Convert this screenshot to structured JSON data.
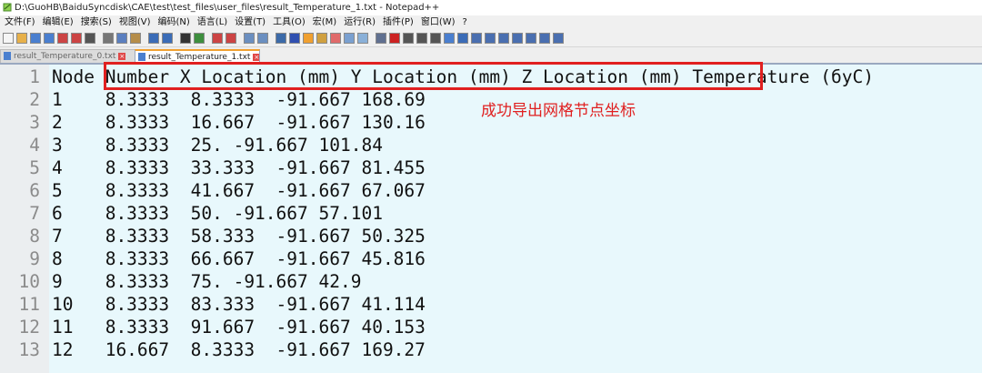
{
  "window": {
    "title": "D:\\GuoHB\\BaiduSyncdisk\\CAE\\test\\test_files\\user_files\\result_Temperature_1.txt - Notepad++"
  },
  "menu": {
    "items": [
      "文件(F)",
      "编辑(E)",
      "搜索(S)",
      "视图(V)",
      "编码(N)",
      "语言(L)",
      "设置(T)",
      "工具(O)",
      "宏(M)",
      "运行(R)",
      "插件(P)",
      "窗口(W)",
      "?"
    ]
  },
  "tabs": [
    {
      "label": "result_Temperature_0.txt",
      "active": false
    },
    {
      "label": "result_Temperature_1.txt",
      "active": true
    }
  ],
  "editor": {
    "lines": [
      {
        "num": "1",
        "text": "Node Number X Location (mm) Y Location (mm) Z Location (mm) Temperature (бyC)"
      },
      {
        "num": "2",
        "text": "1    8.3333  8.3333  -91.667 168.69"
      },
      {
        "num": "3",
        "text": "2    8.3333  16.667  -91.667 130.16"
      },
      {
        "num": "4",
        "text": "3    8.3333  25. -91.667 101.84"
      },
      {
        "num": "5",
        "text": "4    8.3333  33.333  -91.667 81.455"
      },
      {
        "num": "6",
        "text": "5    8.3333  41.667  -91.667 67.067"
      },
      {
        "num": "7",
        "text": "6    8.3333  50. -91.667 57.101"
      },
      {
        "num": "8",
        "text": "7    8.3333  58.333  -91.667 50.325"
      },
      {
        "num": "9",
        "text": "8    8.3333  66.667  -91.667 45.816"
      },
      {
        "num": "10",
        "text": "9    8.3333  75. -91.667 42.9"
      },
      {
        "num": "11",
        "text": "10   8.3333  83.333  -91.667 41.114"
      },
      {
        "num": "12",
        "text": "11   8.3333  91.667  -91.667 40.153"
      },
      {
        "num": "13",
        "text": "12   16.667  8.3333  -91.667 169.27"
      }
    ]
  },
  "annotation": {
    "text": "成功导出网格节点坐标",
    "color": "#e02020"
  },
  "colors": {
    "editor_bg": "#e8f8fc",
    "gutter_bg": "#ebeef0",
    "highlight": "#e02020"
  }
}
